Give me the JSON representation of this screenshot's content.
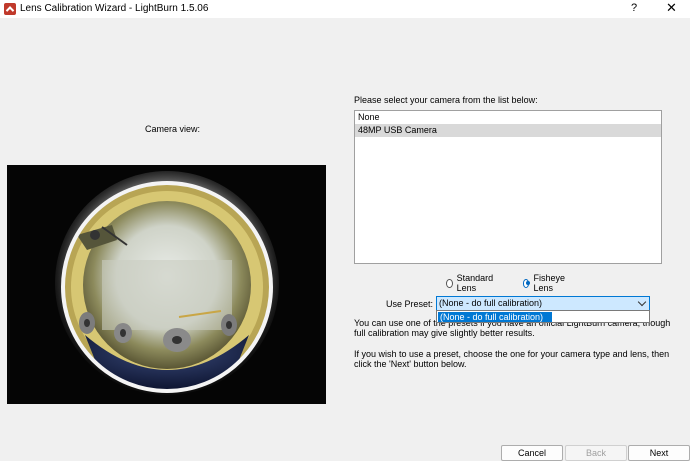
{
  "window": {
    "title": "Lens Calibration Wizard - LightBurn 1.5.06",
    "help": "?",
    "close": "✕"
  },
  "camera_view": {
    "label": "Camera view:"
  },
  "camera_list": {
    "label": "Please select your camera from the list below:",
    "items": [
      {
        "label": "None"
      },
      {
        "label": "48MP USB Camera"
      }
    ],
    "selected": "48MP USB Camera"
  },
  "lens_type": {
    "standard_label": "Standard Lens",
    "fisheye_label": "Fisheye Lens",
    "selected": "Fisheye Lens"
  },
  "preset": {
    "label": "Use Preset:",
    "value": "(None - do full calibration)",
    "options": [
      "(None - do full calibration)"
    ]
  },
  "info": {
    "line1": "You can use one of the presets if you have an official LightBurn camera, though full calibration may give slightly better results.",
    "line2": "If you wish to use a preset, choose the one for your camera type and lens, then click the 'Next' button below."
  },
  "buttons": {
    "cancel": "Cancel",
    "back": "Back",
    "next": "Next"
  },
  "colors": {
    "accent": "#0078d4",
    "select_highlight": "#cde8ff",
    "list_selected": "#d9d9d9"
  }
}
